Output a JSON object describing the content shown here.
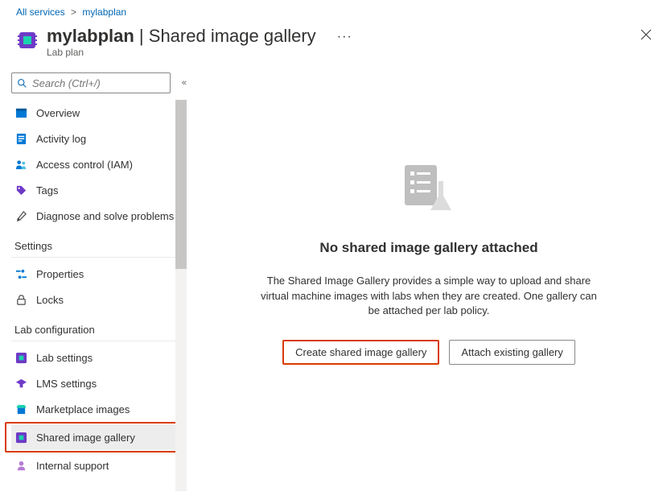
{
  "breadcrumb": {
    "root": "All services",
    "current": "mylabplan"
  },
  "header": {
    "name": "mylabplan",
    "section": "Shared image gallery",
    "subtitle": "Lab plan"
  },
  "search": {
    "placeholder": "Search (Ctrl+/)"
  },
  "nav": {
    "overview": "Overview",
    "activity": "Activity log",
    "iam": "Access control (IAM)",
    "tags": "Tags",
    "diagnose": "Diagnose and solve problems"
  },
  "sections": {
    "settings": "Settings",
    "labconfig": "Lab configuration"
  },
  "settings": {
    "properties": "Properties",
    "locks": "Locks"
  },
  "labconfig": {
    "labsettings": "Lab settings",
    "lms": "LMS settings",
    "marketplace": "Marketplace images",
    "sig": "Shared image gallery",
    "internal": "Internal support"
  },
  "main": {
    "title": "No shared image gallery attached",
    "desc": "The Shared Image Gallery provides a simple way to upload and share virtual machine images with labs when they are created. One gallery can be attached per lab policy.",
    "create": "Create shared image gallery",
    "attach": "Attach existing gallery"
  }
}
